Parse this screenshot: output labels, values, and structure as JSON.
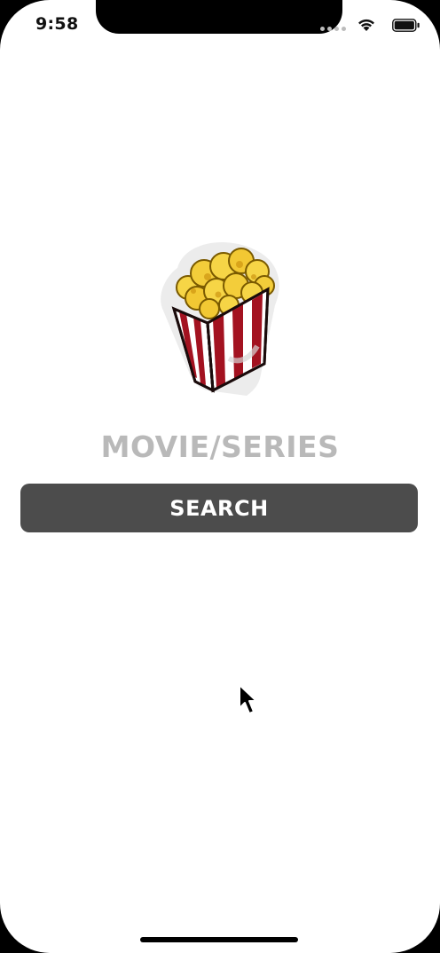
{
  "status_bar": {
    "time": "9:58",
    "icons": [
      "cellular-signal-icon",
      "wifi-icon",
      "battery-icon"
    ]
  },
  "main": {
    "logo_icon": "popcorn-icon",
    "title": "MOVIE/SERIES",
    "search_label": "SEARCH"
  },
  "colors": {
    "background": "#ffffff",
    "title": "#b9b9b9",
    "button_bg": "#4c4c4c",
    "button_text": "#ffffff",
    "popcorn_yellow": "#f4d13a",
    "box_red": "#a31220"
  }
}
